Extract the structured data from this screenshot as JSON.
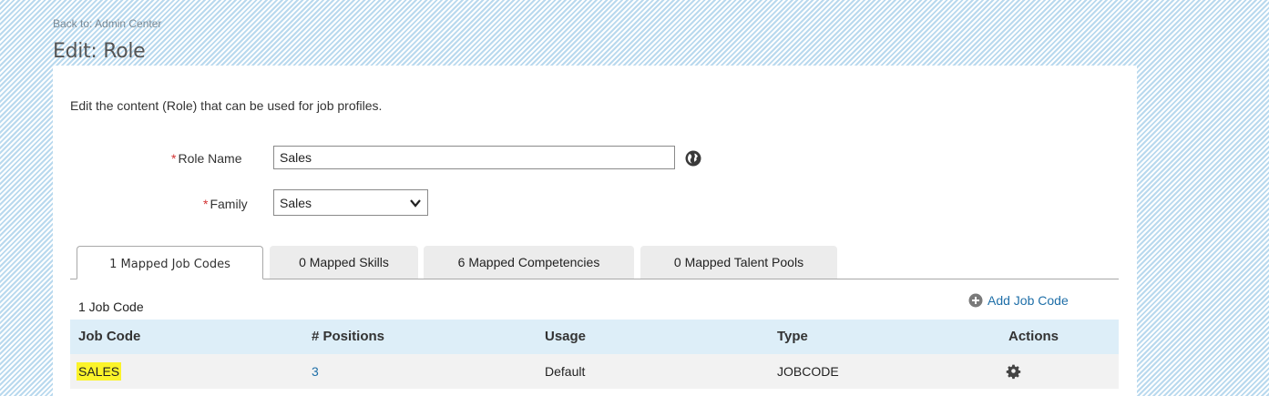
{
  "header": {
    "back_link": "Back to: Admin Center",
    "title": "Edit: Role"
  },
  "form": {
    "description": "Edit the content (Role) that can be used for job profiles.",
    "required_marker": "*",
    "role_name_label": "Role Name",
    "role_name_value": "Sales",
    "family_label": "Family",
    "family_value": "Sales"
  },
  "tabs": [
    {
      "label": "1 Mapped Job Codes",
      "active": true
    },
    {
      "label": "0 Mapped Skills",
      "active": false
    },
    {
      "label": "6 Mapped Competencies",
      "active": false
    },
    {
      "label": "0 Mapped Talent Pools",
      "active": false
    }
  ],
  "jobcodes": {
    "count_text": "1 Job Code",
    "add_label": "Add Job Code",
    "columns": [
      "Job Code",
      "# Positions",
      "Usage",
      "Type",
      "Actions"
    ],
    "rows": [
      {
        "job_code": "SALES",
        "positions": "3",
        "usage": "Default",
        "type": "JOBCODE"
      }
    ]
  },
  "icons": {
    "translate": "globe-icon",
    "add": "plus-circle-icon",
    "actions": "gear-icon"
  },
  "colors": {
    "link": "#1f6fa8",
    "required": "#d23333",
    "highlight": "#fbf32a",
    "header_row": "#ddeef8"
  }
}
